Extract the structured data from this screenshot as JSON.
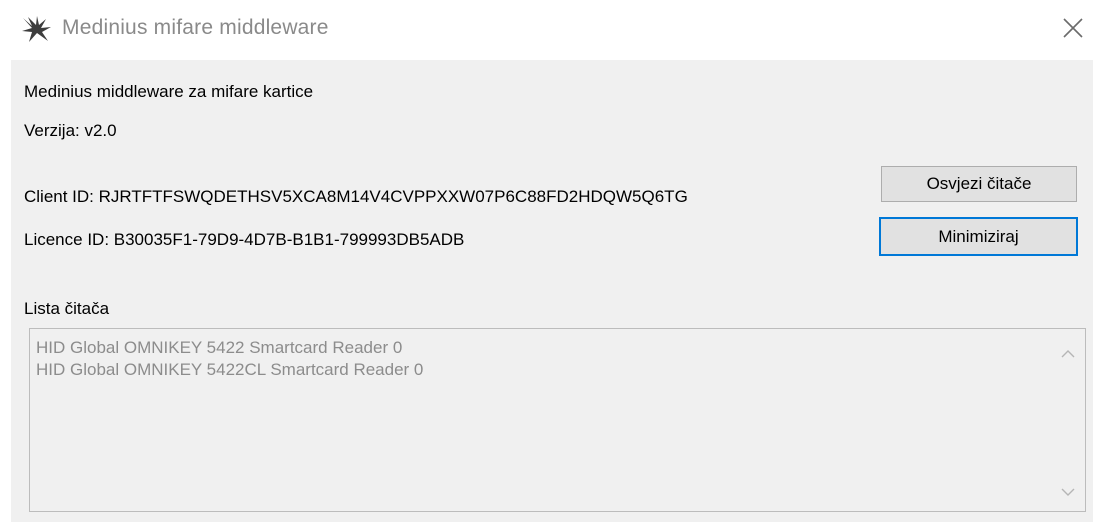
{
  "window": {
    "title": "Medinius mifare middleware"
  },
  "info": {
    "app_description": "Medinius middleware za mifare kartice",
    "version": "Verzija: v2.0",
    "client_id": "Client ID: RJRTFTFSWQDETHSV5XCA8M14V4CVPPXXW07P6C88FD2HDQW5Q6TG",
    "licence_id": "Licence ID: B30035F1-79D9-4D7B-B1B1-799993DB5ADB"
  },
  "buttons": {
    "refresh_label": "Osvjezi čitače",
    "minimize_label": "Minimiziraj"
  },
  "readers": {
    "label": "Lista čitača",
    "items": [
      "HID Global OMNIKEY 5422 Smartcard Reader 0",
      "HID Global OMNIKEY 5422CL Smartcard Reader 0"
    ]
  },
  "icons": {
    "app": "bird-logo-icon",
    "close": "close-icon",
    "scroll_up": "chevron-up-icon",
    "scroll_down": "chevron-down-icon"
  },
  "colors": {
    "focus_border": "#0078d7",
    "window_bg": "#f0f0f0",
    "disabled_text": "#8c8c8c"
  }
}
